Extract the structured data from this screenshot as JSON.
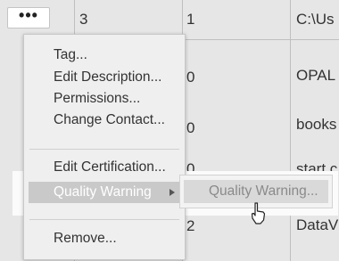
{
  "row_menu_button": {
    "label": "•••"
  },
  "table": {
    "rows": [
      [
        "3",
        "1",
        "C:\\Us"
      ],
      [
        "",
        "0",
        "OPAL"
      ],
      [
        "",
        "0",
        "books"
      ],
      [
        "",
        "0",
        "start.c"
      ],
      [
        "",
        "2",
        "DataV"
      ]
    ]
  },
  "context_menu": {
    "items": [
      "Tag...",
      "Edit Description...",
      "Permissions...",
      "Change Contact...",
      "Edit Certification...",
      "Quality Warning",
      "Remove..."
    ]
  },
  "submenu": {
    "items": [
      "Quality Warning..."
    ]
  },
  "icons": {
    "submenu_arrow": "chevron-right-icon",
    "pointer": "mouse-pointer-icon"
  }
}
